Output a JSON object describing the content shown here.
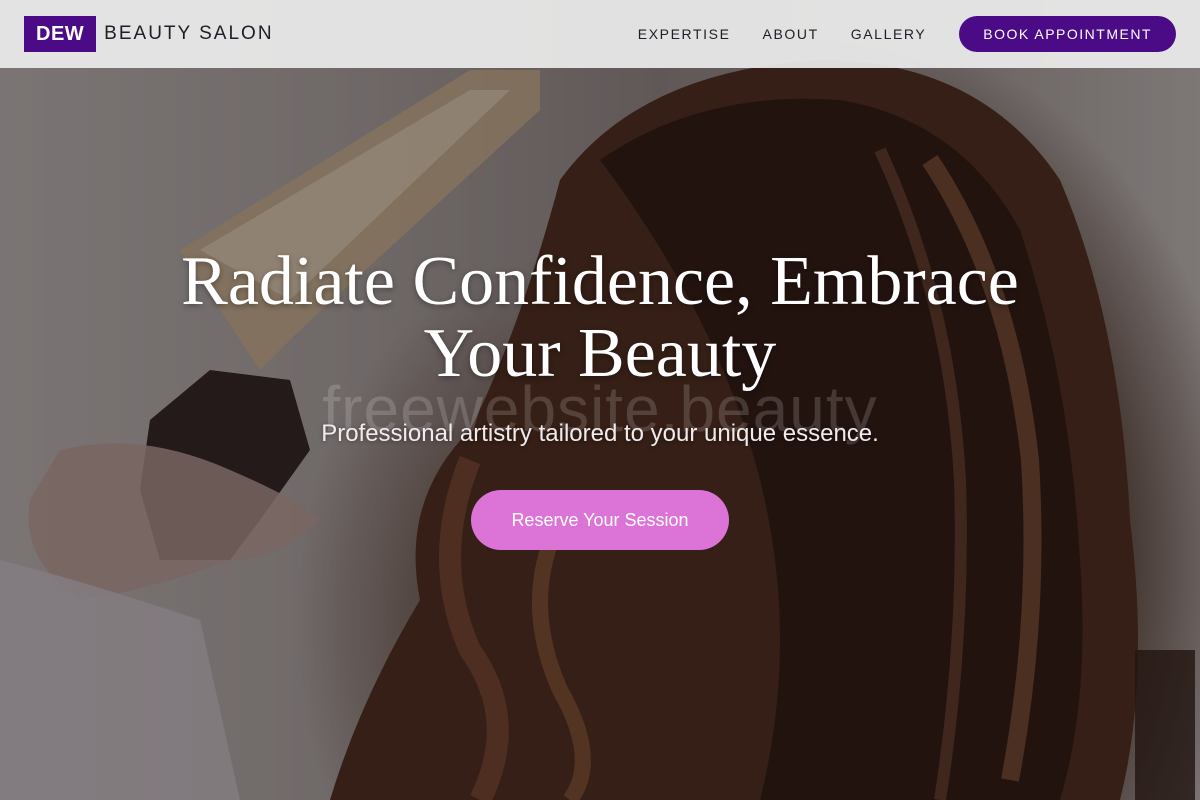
{
  "header": {
    "logo_mark": "DEW",
    "logo_text": "BEAUTY SALON",
    "nav": [
      {
        "label": "EXPERTISE"
      },
      {
        "label": "ABOUT"
      },
      {
        "label": "GALLERY"
      }
    ],
    "book_button": "BOOK APPOINTMENT"
  },
  "hero": {
    "headline_line1": "Radiate Confidence, Embrace",
    "headline_line2": "Your Beauty",
    "watermark": "freewebsite.beauty",
    "subheadline": "Professional artistry tailored to your unique essence.",
    "cta_button": "Reserve Your Session",
    "background_image": "hairstylist-curling-long-brown-hair-photo"
  },
  "colors": {
    "brand_purple": "#4b0a86",
    "cta_pink": "#dc74d8",
    "header_bg": "#ececec"
  }
}
